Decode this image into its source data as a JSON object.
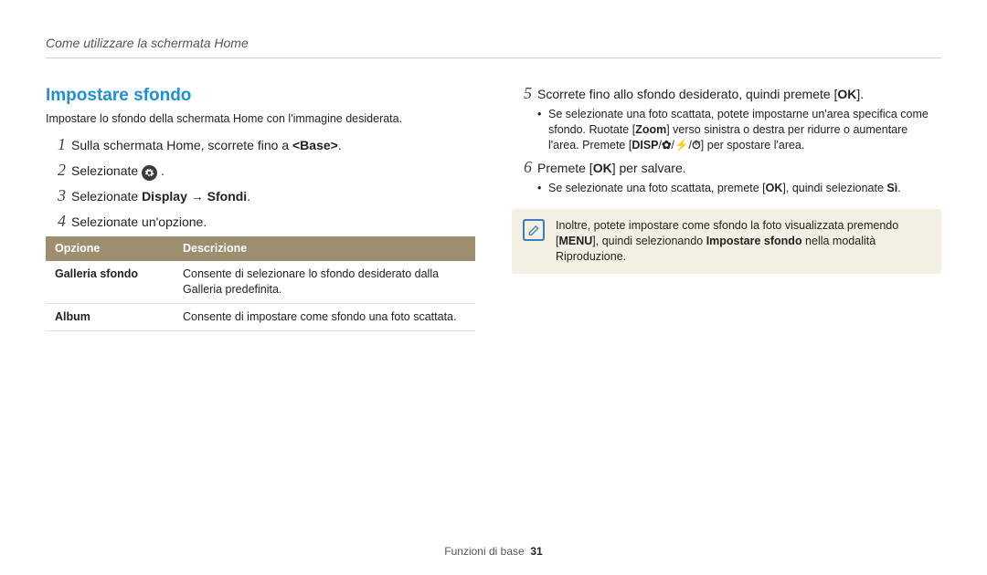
{
  "header": "Come utilizzare la schermata Home",
  "section": {
    "title": "Impostare sfondo",
    "subtitle": "Impostare lo sfondo della schermata Home con l'immagine desiderata."
  },
  "steps_left": {
    "s1_pre": "Sulla schermata Home, scorrete fino a ",
    "s1_base": "<Base>",
    "s1_post": ".",
    "s2_pre": "Selezionate ",
    "s2_post": " .",
    "s3_pre": "Selezionate ",
    "s3_bold": "Display → Sfondi",
    "s3_post": ".",
    "s4": "Selezionate un'opzione."
  },
  "table": {
    "head_opt": "Opzione",
    "head_desc": "Descrizione",
    "rows": [
      {
        "opt": "Galleria sfondo",
        "desc": "Consente di selezionare lo sfondo desiderato dalla Galleria predefinita."
      },
      {
        "opt": "Album",
        "desc": "Consente di impostare come sfondo una foto scattata."
      }
    ]
  },
  "steps_right": {
    "s5_pre": "Scorrete fino allo sfondo desiderato, quindi premete [",
    "s5_ok": "OK",
    "s5_post": "].",
    "s5_sub_a_pre": "Se selezionate una foto scattata, potete impostarne un'area specifica come sfondo. Ruotate [",
    "s5_sub_a_zoom": "Zoom",
    "s5_sub_a_mid": "] verso sinistra o destra per ridurre o aumentare l'area. Premete [",
    "s5_sub_a_disp": "DISP",
    "s5_sub_a_sep1": "/",
    "s5_sub_a_macro": "✿",
    "s5_sub_a_sep2": "/",
    "s5_sub_a_flash": "⚡",
    "s5_sub_a_sep3": "/",
    "s5_sub_a_timer": "⏱",
    "s5_sub_a_post": "] per spostare l'area.",
    "s6_pre": "Premete [",
    "s6_ok": "OK",
    "s6_post": "] per salvare.",
    "s6_sub_pre": "Se selezionate una foto scattata, premete [",
    "s6_sub_ok": "OK",
    "s6_sub_mid": "], quindi selezionate ",
    "s6_sub_si": "Sì",
    "s6_sub_post": "."
  },
  "note": {
    "line_pre": "Inoltre, potete impostare come sfondo la foto visualizzata premendo [",
    "menu": "MENU",
    "line_mid": "], quindi selezionando ",
    "bold": "Impostare sfondo",
    "line_post": " nella modalità Riproduzione."
  },
  "footer": {
    "label": "Funzioni di base",
    "page": "31"
  }
}
